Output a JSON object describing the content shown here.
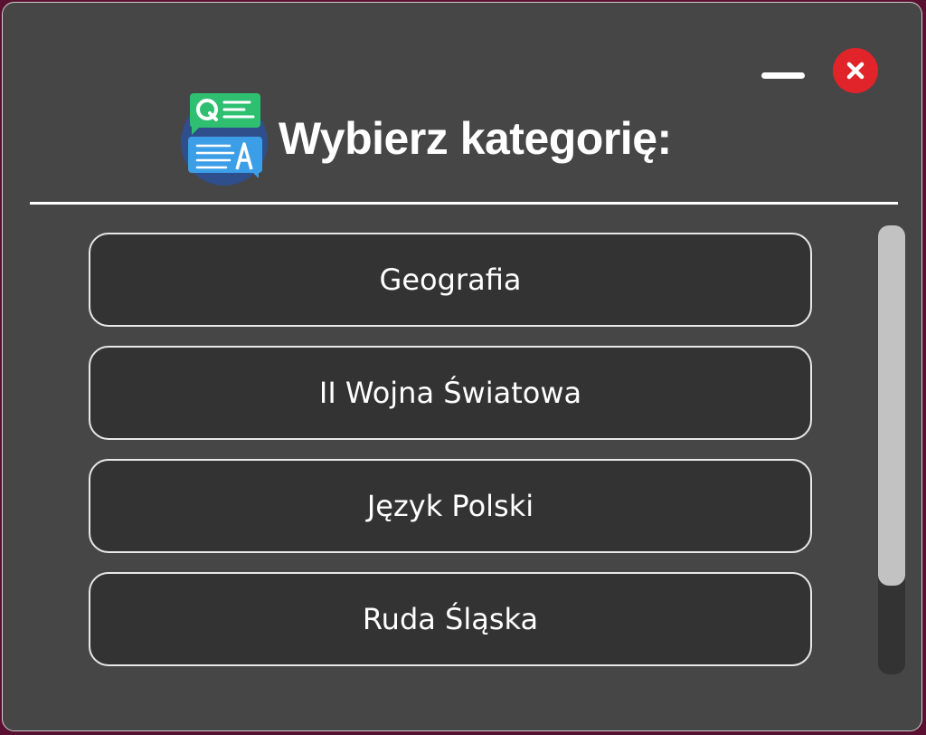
{
  "window": {
    "title": "Wybierz kategorię:",
    "logo_icon": "quiz-qa-icon",
    "minimize_icon": "minimize-icon",
    "close_icon": "close-icon"
  },
  "categories": [
    {
      "label": "Geografia"
    },
    {
      "label": "II Wojna Światowa"
    },
    {
      "label": "Język Polski"
    },
    {
      "label": "Ruda Śląska"
    }
  ],
  "colors": {
    "window_background": "#464646",
    "button_background": "#333333",
    "button_border": "#e8e8e8",
    "close_button": "#e0242a",
    "text": "#ffffff",
    "scrollbar_track": "#333333",
    "scrollbar_thumb": "#c2c2c2"
  }
}
